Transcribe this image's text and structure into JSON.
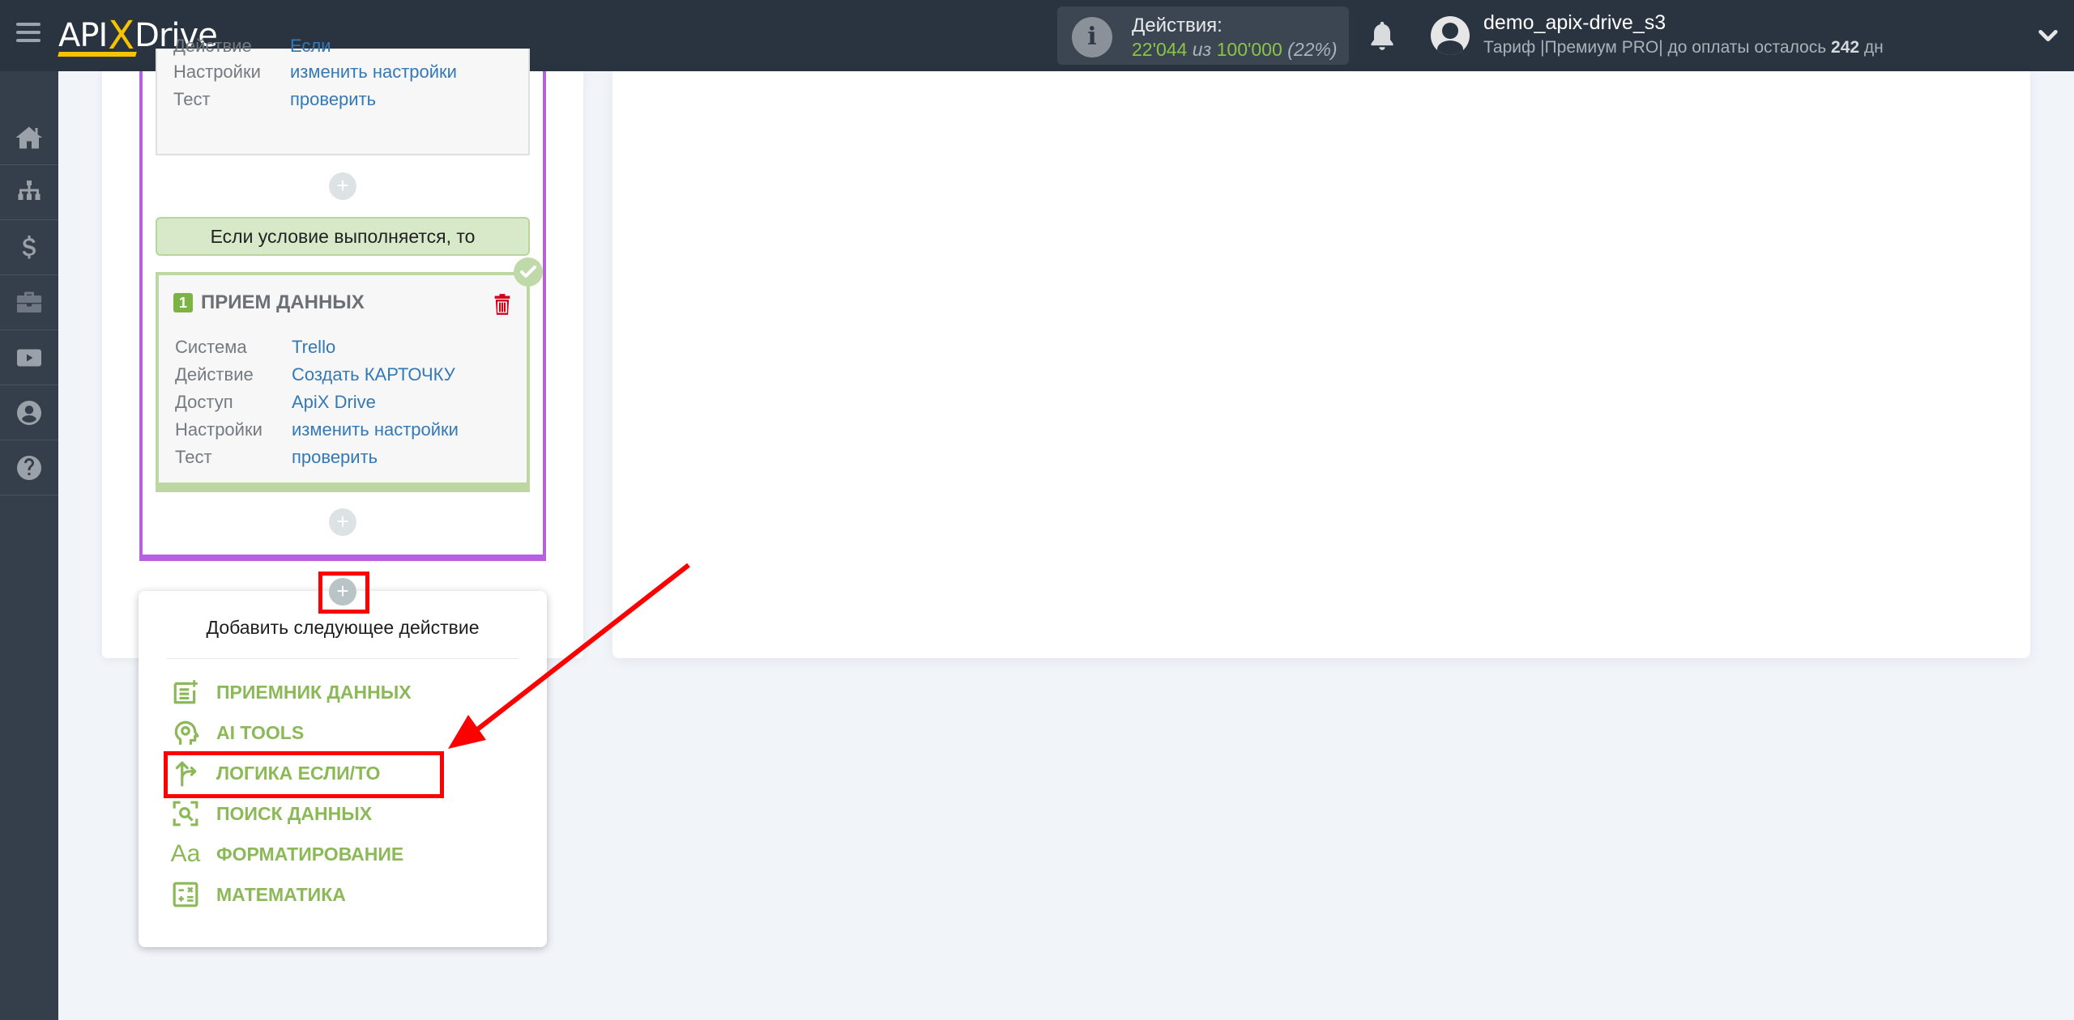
{
  "header": {
    "logo": {
      "api": "API",
      "x": "X",
      "drive": "Drive"
    },
    "actions": {
      "label": "Действия:",
      "used": "22'044",
      "of": "из",
      "total": "100'000",
      "percent": "(22%)"
    },
    "user": {
      "name": "demo_apix-drive_s3",
      "plan_prefix": "Тариф |Премиум PRO| до оплаты осталось",
      "days": "242",
      "days_suffix": "дн"
    }
  },
  "sidebar": {
    "items": [
      {
        "icon": "home-icon"
      },
      {
        "icon": "sitemap-icon"
      },
      {
        "icon": "dollar-icon"
      },
      {
        "icon": "briefcase-icon"
      },
      {
        "icon": "youtube-icon"
      },
      {
        "icon": "user-circle-icon"
      },
      {
        "icon": "question-circle-icon"
      }
    ]
  },
  "flow": {
    "top_step": {
      "rows": [
        {
          "key": "Действие",
          "value": "Если"
        },
        {
          "key": "Настройки",
          "value": "изменить настройки"
        },
        {
          "key": "Тест",
          "value": "проверить"
        }
      ]
    },
    "condition_label": "Если условие выполняется, то",
    "receiver": {
      "number": "1",
      "title": "ПРИЕМ ДАННЫХ",
      "rows": [
        {
          "key": "Система",
          "value": "Trello"
        },
        {
          "key": "Действие",
          "value": "Создать КАРТОЧКУ"
        },
        {
          "key": "Доступ",
          "value": "ApiX Drive"
        },
        {
          "key": "Настройки",
          "value": "изменить настройки"
        },
        {
          "key": "Тест",
          "value": "проверить"
        }
      ]
    },
    "plus_symbol": "+"
  },
  "popup": {
    "title": "Добавить следующее действие",
    "items": [
      {
        "label": "ПРИЕМНИК ДАННЫХ",
        "icon": "data-receiver-icon"
      },
      {
        "label": "AI TOOLS",
        "icon": "ai-head-icon"
      },
      {
        "label": "ЛОГИКА ЕСЛИ/ТО",
        "icon": "branch-arrow-icon"
      },
      {
        "label": "ПОИСК ДАННЫХ",
        "icon": "search-scan-icon"
      },
      {
        "label": "ФОРМАТИРОВАНИЕ",
        "icon": "text-format-icon",
        "glyph": "Aa"
      },
      {
        "label": "МАТЕМАТИКА",
        "icon": "calculator-icon"
      }
    ]
  },
  "colors": {
    "accent_green": "#8bb957",
    "frame_purple": "#b760e0",
    "link_blue": "#3479b7",
    "annotation_red": "#ff0000",
    "header_bg": "#2a3441"
  }
}
